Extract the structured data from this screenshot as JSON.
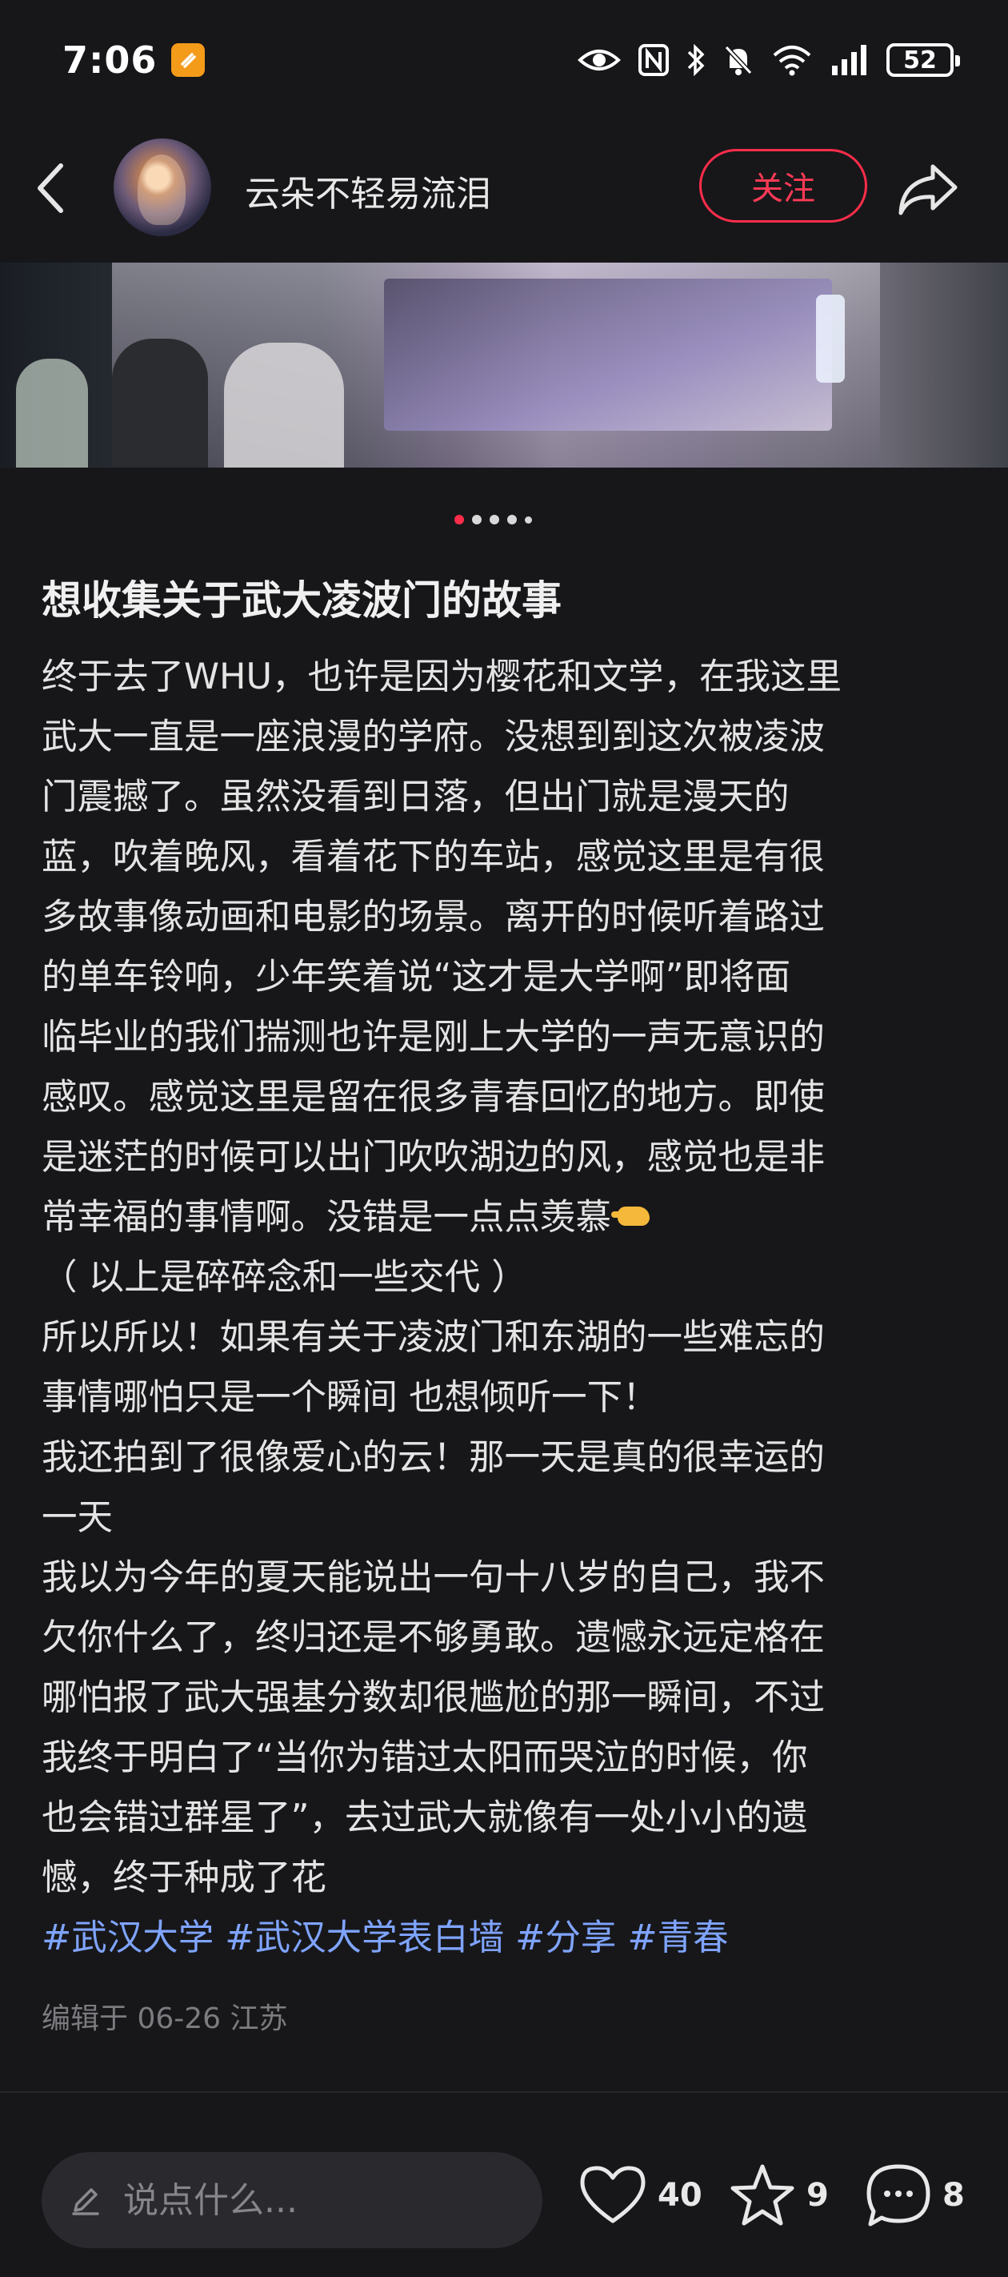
{
  "status_bar": {
    "time": "7:06",
    "battery": "52",
    "icons": [
      "eye-icon",
      "nfc-icon",
      "bluetooth-icon",
      "mute-icon",
      "wifi-icon",
      "signal-icon",
      "battery-icon"
    ]
  },
  "header": {
    "username": "云朵不轻易流泪",
    "follow_label": "关注"
  },
  "carousel": {
    "current": 1,
    "total": 5
  },
  "post": {
    "title": "想收集关于武大凌波门的故事",
    "lines": [
      "终于去了WHU，也许是因为樱花和文学，在我这里",
      "武大一直是一座浪漫的学府。没想到到这次被凌波",
      "门震撼了。虽然没看到日落，但出门就是漫天的",
      "蓝，吹着晚风，看着花下的车站，感觉这里是有很",
      "多故事像动画和电影的场景。离开的时候听着路过",
      "的单车铃响，少年笑着说“这才是大学啊”即将面",
      "临毕业的我们揣测也许是刚上大学的一声无意识的",
      "感叹。感觉这里是留在很多青春回忆的地方。即使",
      "是迷茫的时候可以出门吹吹湖边的风，感觉也是非",
      "常幸福的事情啊。没错是一点点羡慕",
      "（ 以上是碎碎念和一些交代 ）",
      "所以所以！如果有关于凌波门和东湖的一些难忘的",
      "事情哪怕只是一个瞬间 也想倾听一下！",
      "我还拍到了很像爱心的云！那一天是真的很幸运的",
      "一天",
      "我以为今年的夏天能说出一句十八岁的自己，我不",
      "欠你什么了，终归还是不够勇敢。遗憾永远定格在",
      "哪怕报了武大强基分数却很尴尬的那一瞬间，不过",
      "我终于明白了“当你为错过太阳而哭泣的时候，你",
      "也会错过群星了”，去过武大就像有一处小小的遗",
      "憾，终于种成了花"
    ],
    "tags": [
      "#武汉大学",
      "#武汉大学表白墙",
      "#分享",
      "#青春"
    ],
    "edit_meta": "编辑于 06-26 江苏"
  },
  "bottom_bar": {
    "comment_placeholder": "说点什么...",
    "likes": "40",
    "favorites": "9",
    "comments": "8"
  },
  "colors": {
    "background": "#17171a",
    "accent": "#ff2d4a",
    "tag": "#7fa4ff"
  }
}
